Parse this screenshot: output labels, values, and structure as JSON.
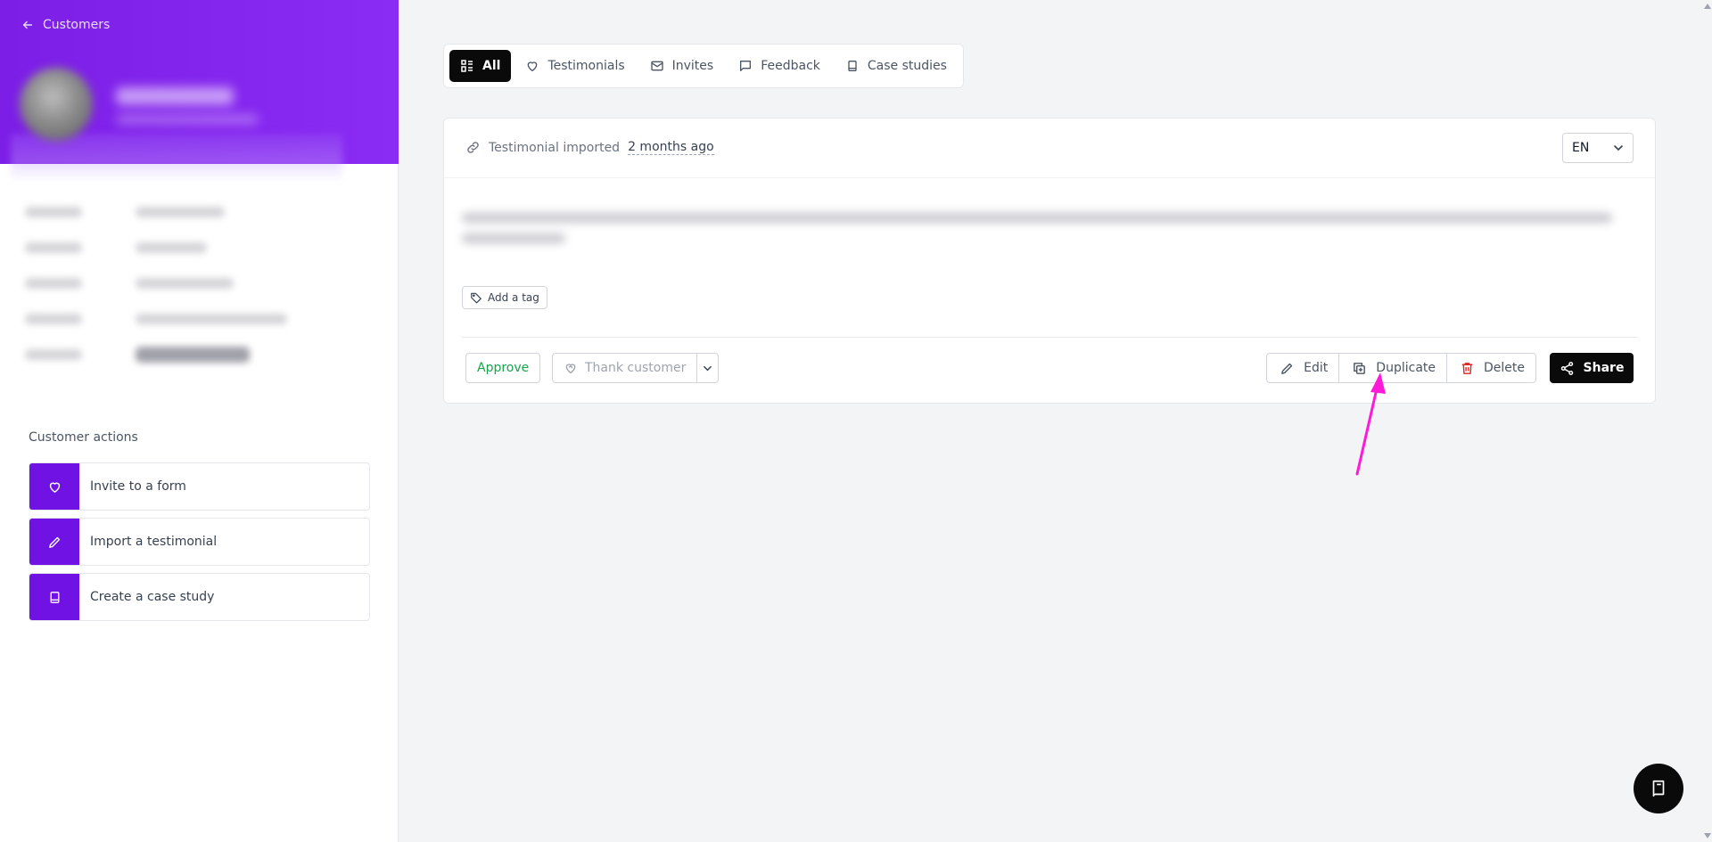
{
  "sidebar": {
    "back_label": "Customers",
    "actions_title": "Customer actions",
    "actions": [
      {
        "label": "Invite to a form",
        "icon": "heart-icon"
      },
      {
        "label": "Import a testimonial",
        "icon": "pencil-icon"
      },
      {
        "label": "Create a case study",
        "icon": "book-icon"
      }
    ]
  },
  "tabs": [
    {
      "label": "All",
      "icon": "list-icon",
      "active": true
    },
    {
      "label": "Testimonials",
      "icon": "heart-icon",
      "active": false
    },
    {
      "label": "Invites",
      "icon": "mail-icon",
      "active": false
    },
    {
      "label": "Feedback",
      "icon": "message-icon",
      "active": false
    },
    {
      "label": "Case studies",
      "icon": "book-icon",
      "active": false
    }
  ],
  "card": {
    "source_text": "Testimonial imported",
    "time_ago": "2 months ago",
    "language": "EN",
    "add_tag_label": "Add a tag",
    "approve_label": "Approve",
    "thank_label": "Thank customer",
    "edit_label": "Edit",
    "duplicate_label": "Duplicate",
    "delete_label": "Delete",
    "share_label": "Share"
  },
  "colors": {
    "brand": "#7012e4",
    "approve": "#16a34a",
    "delete": "#dc2626",
    "annotation": "#ff1ad9"
  }
}
